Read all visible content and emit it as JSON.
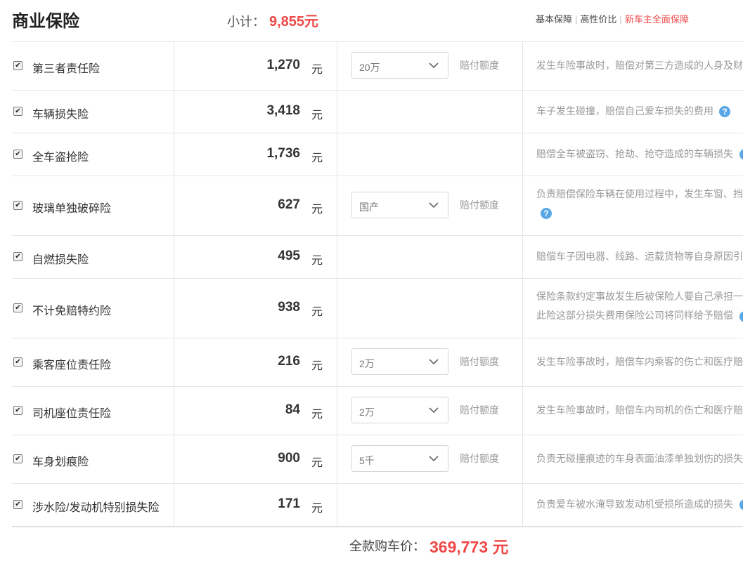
{
  "header": {
    "title": "商业保险",
    "subtotal_label": "小计：",
    "subtotal_value": "9,855元",
    "plans": [
      "基本保障",
      "高性价比",
      "新车主全面保障"
    ]
  },
  "rows": [
    {
      "name": "第三者责任险",
      "price": "1,270",
      "unit": "元",
      "select": "20万",
      "label": "赔付额度",
      "desc": [
        "发生车险事故时，赔偿对第三方造成的人身及财"
      ]
    },
    {
      "name": "车辆损失险",
      "price": "3,418",
      "unit": "元",
      "desc": [
        "车子发生碰撞，赔偿自己爱车损失的费用"
      ]
    },
    {
      "name": "全车盗抢险",
      "price": "1,736",
      "unit": "元",
      "desc": [
        "赔偿全车被盗窃、抢劫、抢夺造成的车辆损失"
      ]
    },
    {
      "name": "玻璃单独破碎险",
      "price": "627",
      "unit": "元",
      "select": "国产",
      "label": "赔付额度",
      "desc": [
        "负责赔偿保险车辆在使用过程中，发生车窗、挡"
      ]
    },
    {
      "name": "自燃损失险",
      "price": "495",
      "unit": "元",
      "desc": [
        "赔偿车子因电器、线路、运载货物等自身原因引"
      ]
    },
    {
      "name": "不计免赔特约险",
      "price": "938",
      "unit": "元",
      "desc": [
        "保险条款约定事故发生后被保险人要自己承担一",
        "此险这部分损失费用保险公司将同样给予赔偿"
      ]
    },
    {
      "name": "乘客座位责任险",
      "price": "216",
      "unit": "元",
      "select": "2万",
      "label": "赔付额度",
      "desc": [
        "发生车险事故时，赔偿车内乘客的伤亡和医疗赔"
      ]
    },
    {
      "name": "司机座位责任险",
      "price": "84",
      "unit": "元",
      "select": "2万",
      "label": "赔付额度",
      "desc": [
        "发生车险事故时，赔偿车内司机的伤亡和医疗赔"
      ]
    },
    {
      "name": "车身划痕险",
      "price": "900",
      "unit": "元",
      "select": "5千",
      "label": "赔付额度",
      "desc": [
        "负责无碰撞痕迹的车身表面油漆单独划伤的损失"
      ]
    },
    {
      "name": "涉水险/发动机特别损失险",
      "price": "171",
      "unit": "元",
      "desc": [
        "负责爱车被水淹导致发动机受损所造成的损失"
      ]
    }
  ],
  "footer": {
    "label": "全款购车价：",
    "value": "369,773 元"
  },
  "colors": {
    "accent": "#f04848",
    "help": "#5aa7e8"
  }
}
